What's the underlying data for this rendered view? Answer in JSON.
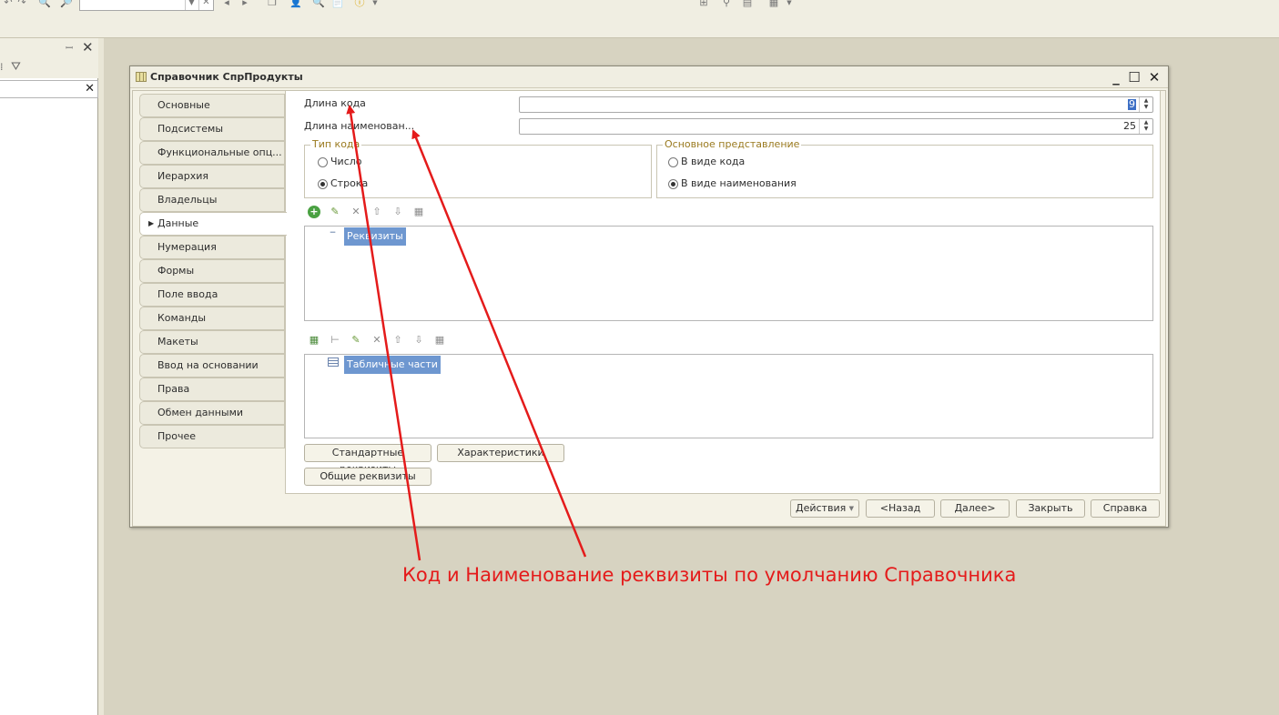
{
  "toolbar": {
    "icons": [
      "redo-icon",
      "find-icon",
      "zoom-icon",
      "combo-dropdown-icon",
      "clear-icon",
      "nav-back-icon",
      "nav-forward-icon",
      "copy-icon",
      "user-icon",
      "search-doc-icon",
      "notes-icon",
      "info-icon",
      "tree-icon",
      "filter-icon",
      "layout-icon",
      "grid-icon"
    ],
    "search_value": ""
  },
  "leftpanel": {
    "pin_label": "ꟷ",
    "close_label": "✕"
  },
  "window": {
    "title": "Справочник СпрПродукты",
    "minimize": "_",
    "maximize": "☐",
    "close": "✕"
  },
  "nav": {
    "items": [
      {
        "label": "Основные"
      },
      {
        "label": "Подсистемы"
      },
      {
        "label": "Функциональные опц..."
      },
      {
        "label": "Иерархия"
      },
      {
        "label": "Владельцы"
      },
      {
        "label": "Данные"
      },
      {
        "label": "Нумерация"
      },
      {
        "label": "Формы"
      },
      {
        "label": "Поле ввода"
      },
      {
        "label": "Команды"
      },
      {
        "label": "Макеты"
      },
      {
        "label": "Ввод на основании"
      },
      {
        "label": "Права"
      },
      {
        "label": "Обмен данными"
      },
      {
        "label": "Прочее"
      }
    ],
    "active_index": 5
  },
  "data_tab": {
    "code_length_label": "Длина кода",
    "code_length_value": "9",
    "name_length_label": "Длина наименован...",
    "name_length_value": "25",
    "code_type": {
      "title": "Тип кода",
      "options": [
        "Число",
        "Строка"
      ],
      "selected": "Строка"
    },
    "main_presentation": {
      "title": "Основное представление",
      "options": [
        "В виде кода",
        "В виде наименования"
      ],
      "selected": "В виде наименования"
    },
    "attributes_tree_root": "Реквизиты",
    "tabular_tree_root": "Табличные части",
    "buttons": {
      "standard_attributes": "Стандартные реквизиты",
      "characteristics": "Характеристики",
      "common_attributes": "Общие реквизиты"
    }
  },
  "footer": {
    "actions": "Действия",
    "back": "<Назад",
    "next": "Далее>",
    "close": "Закрыть",
    "help": "Справка"
  },
  "annotation": {
    "text": "Код и Наименование реквизиты по умолчанию Справочника",
    "color": "#e41b1b"
  }
}
